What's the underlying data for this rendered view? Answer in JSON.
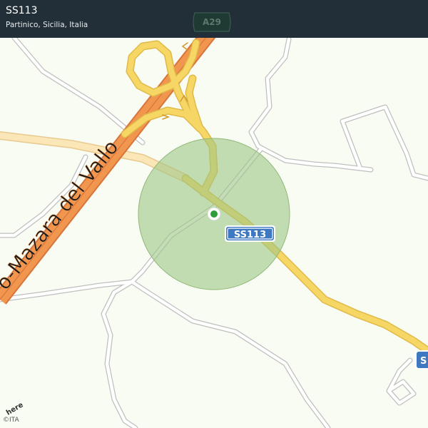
{
  "header": {
    "title": "SS113",
    "subtitle": "Partinico, Sicilia, Italia"
  },
  "labels": {
    "highway_name": "o-Mazara del Vallo",
    "highway_shield": "A29",
    "road_shield": "SS113",
    "road_shield_edge": "S"
  },
  "attribution": {
    "logo": "here",
    "copyright": "©ITA"
  },
  "colors": {
    "background": "#f8fcf2",
    "header_bg": "#222f38",
    "motorway": "#f0964f",
    "primary_road": "#f6d766",
    "secondary_road": "#fbe6b8",
    "minor_road": "#ffffff",
    "accuracy_circle": "#b7d6a4",
    "location_dot": "#2e9e3a",
    "shield_blue": "#3d78c0"
  },
  "icons": {
    "location": "location-dot-icon",
    "accuracy": "accuracy-circle-icon",
    "oneway": "oneway-arrow-icon"
  }
}
